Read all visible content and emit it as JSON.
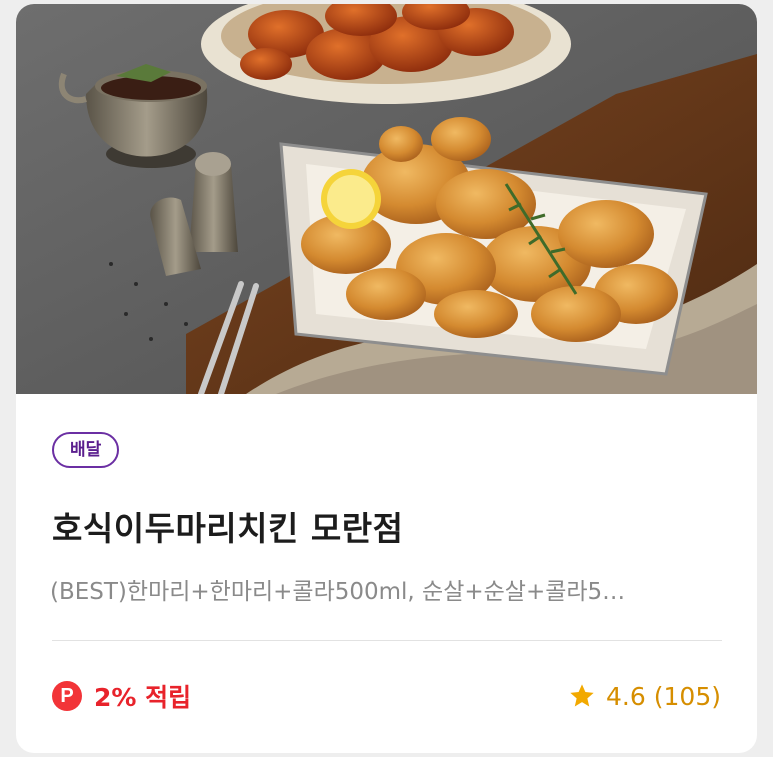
{
  "store": {
    "delivery_badge": "배달",
    "name": "호식이두마리치킨 모란점",
    "menu_summary": "(BEST)한마리+한마리+콜라500ml, 순살+순살+콜라5…",
    "point_icon_label": "P",
    "point_text": "2% 적립",
    "rating": "4.6",
    "review_count": "(105)"
  },
  "colors": {
    "badge_border": "#6b2fa3",
    "point_red": "#f23438",
    "rating_gold": "#d68e00"
  },
  "icons": {
    "point": "point-icon",
    "rating": "star-icon"
  }
}
